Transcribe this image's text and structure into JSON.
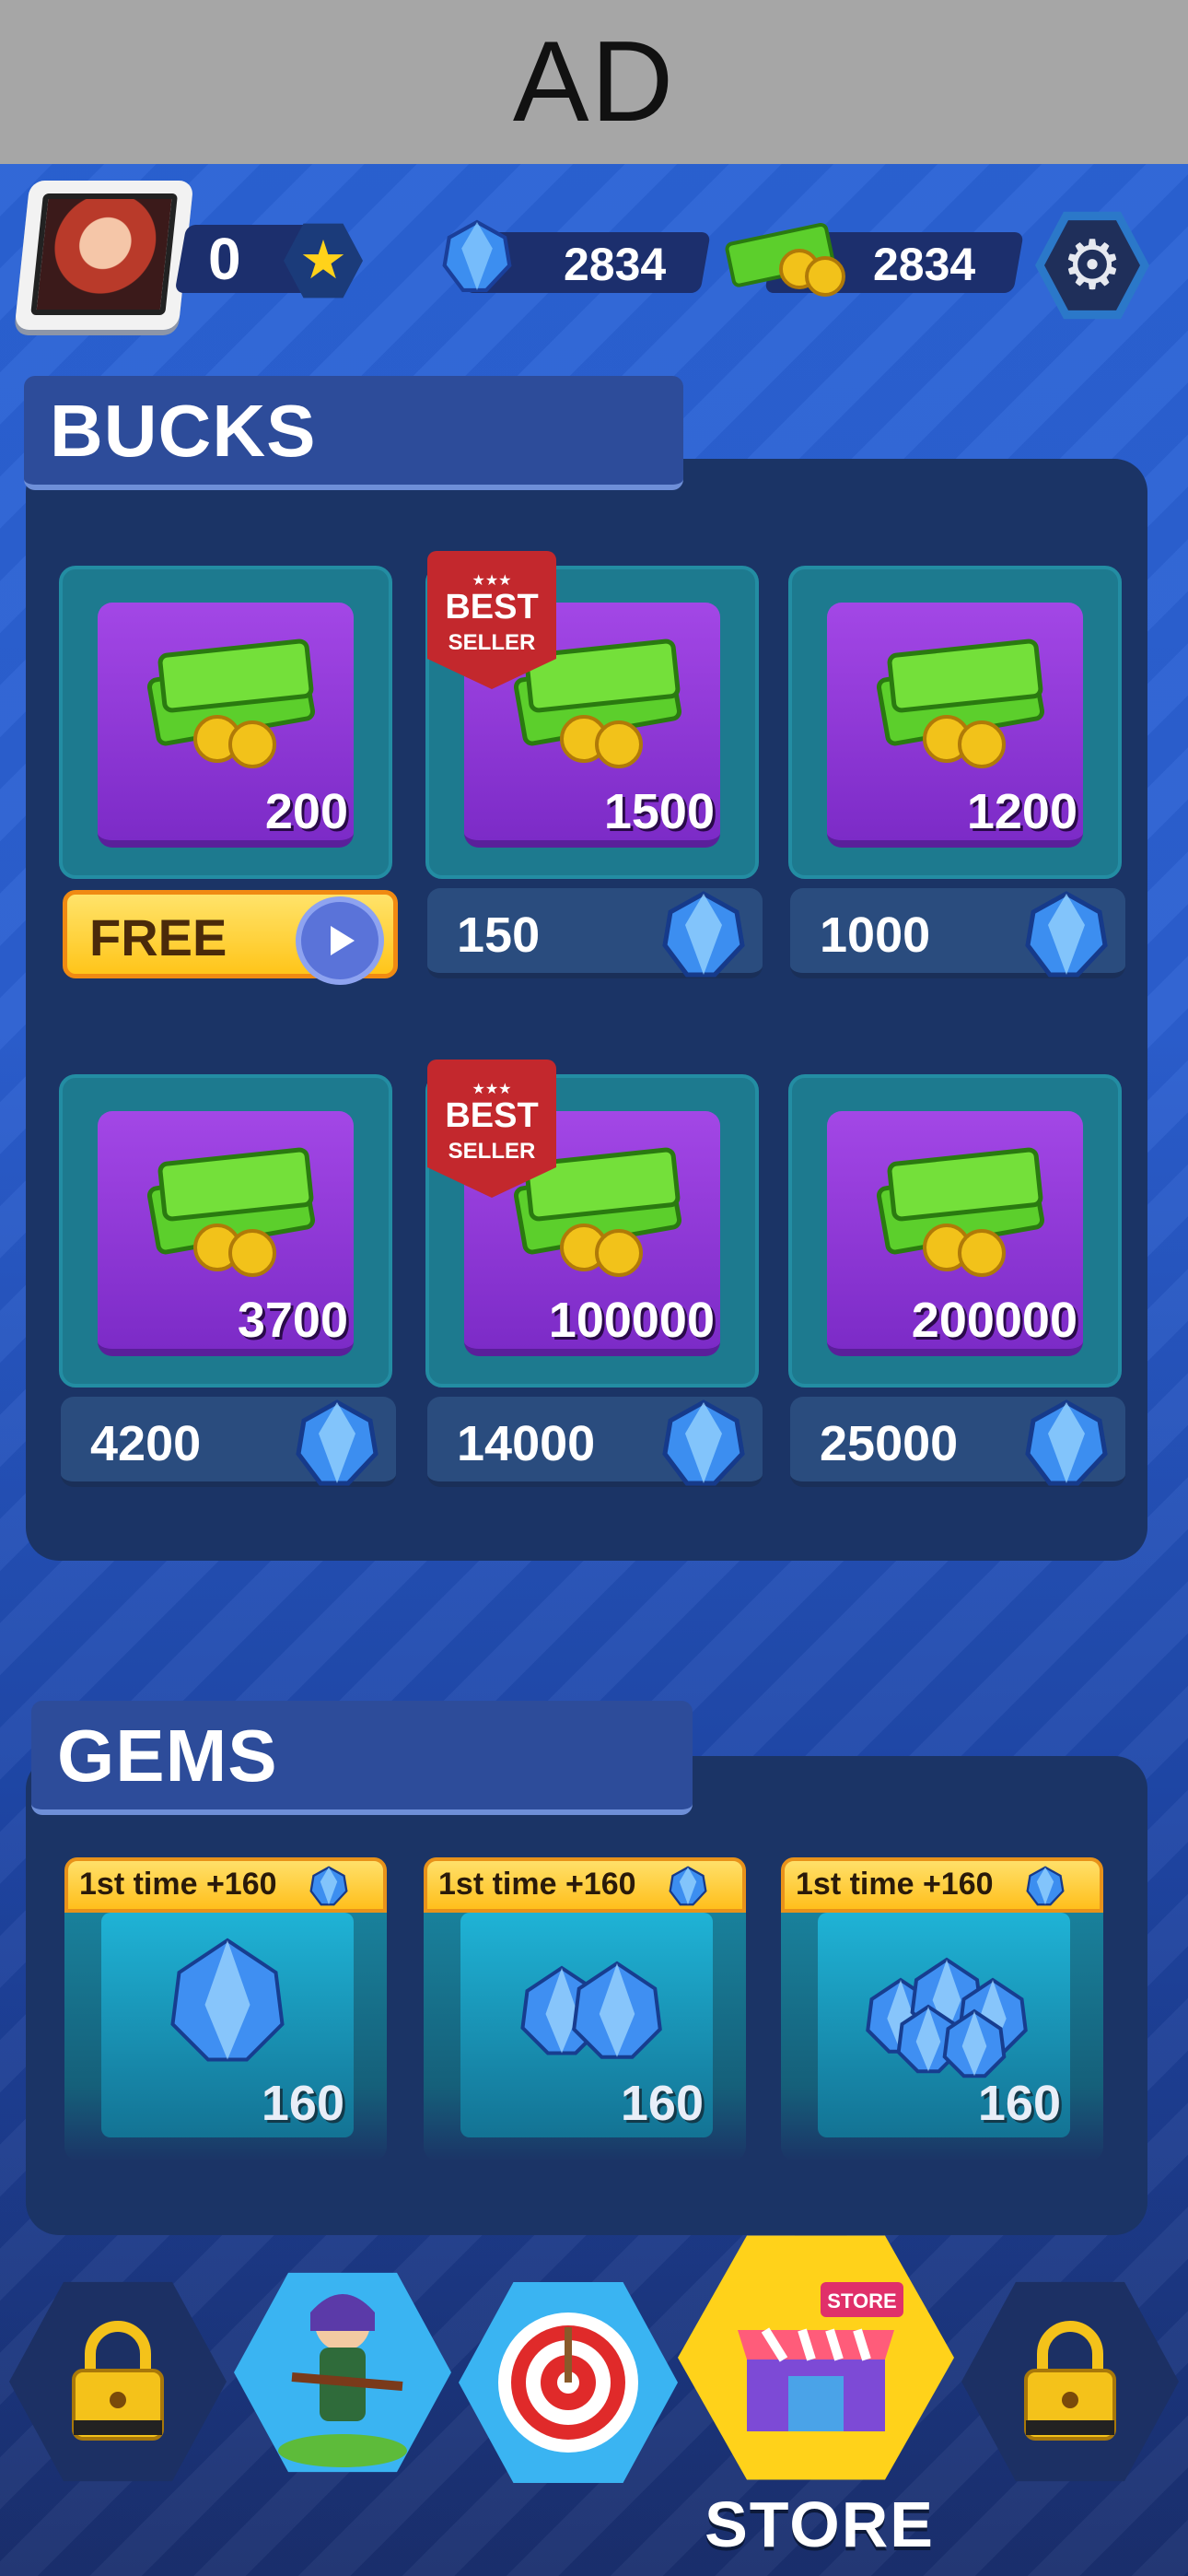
{
  "ad": {
    "label": "AD"
  },
  "hud": {
    "stars": "0",
    "gems": "2834",
    "cash": "2834"
  },
  "bucks": {
    "title": "BUCKS",
    "items": [
      {
        "amount": "200",
        "price": "FREE",
        "best_seller": false,
        "free": true
      },
      {
        "amount": "1500",
        "price": "150",
        "best_seller": true,
        "free": false
      },
      {
        "amount": "1200",
        "price": "1000",
        "best_seller": false,
        "free": false
      },
      {
        "amount": "3700",
        "price": "4200",
        "best_seller": false,
        "free": false
      },
      {
        "amount": "100000",
        "price": "14000",
        "best_seller": true,
        "free": false
      },
      {
        "amount": "200000",
        "price": "25000",
        "best_seller": false,
        "free": false
      }
    ],
    "ribbon": {
      "best": "BEST",
      "seller": "SELLER",
      "stars": "★★★"
    }
  },
  "gems": {
    "title": "GEMS",
    "items": [
      {
        "tag": "1st time +160",
        "amount": "160",
        "icon": "gem-single-icon"
      },
      {
        "tag": "1st time +160",
        "amount": "160",
        "icon": "gem-pile-icon"
      },
      {
        "tag": "1st time +160",
        "amount": "160",
        "icon": "gem-heap-icon"
      }
    ]
  },
  "nav": {
    "items": [
      {
        "icon": "locked-tab-icon",
        "locked": true
      },
      {
        "icon": "hero-archer-icon",
        "locked": false
      },
      {
        "icon": "target-icon",
        "locked": false
      },
      {
        "icon": "store-icon",
        "locked": false,
        "active": true,
        "label": "STORE"
      },
      {
        "icon": "locked-tab-icon",
        "locked": true
      }
    ]
  },
  "colors": {
    "background": "#2a63d6",
    "panel": "#1b3466",
    "card": "#1d7a8f",
    "purple_tile": "#a347e6",
    "gold": "#ffc51a",
    "ribbon": "#c3282d"
  }
}
